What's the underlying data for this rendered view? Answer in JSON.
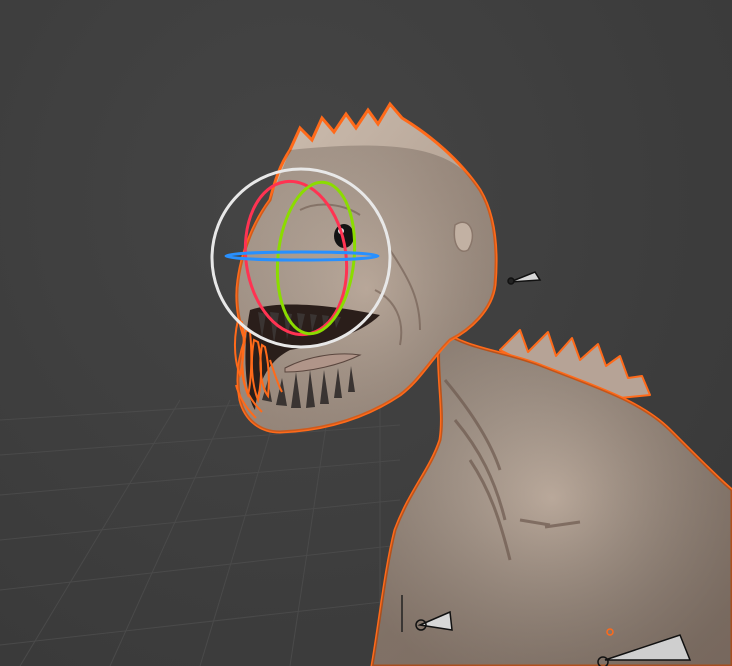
{
  "app": "3D Viewport",
  "scene": {
    "object": "creature-model",
    "selection_outline_color": "#ff6a1a",
    "background_color": "#3d3d3d",
    "grid_color": "#4a4a4a"
  },
  "rotate_gizmo": {
    "trackball_color": "#e8e8e8",
    "x_axis_color": "#ff3352",
    "y_axis_color": "#8bdc00",
    "z_axis_color": "#2890ff"
  },
  "icons": [
    "rotate-gizmo-icon",
    "light-icon",
    "camera-icon",
    "empty-icon"
  ]
}
